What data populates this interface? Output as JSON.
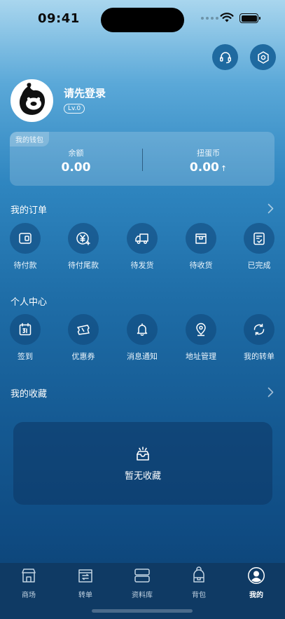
{
  "status_bar": {
    "time": "09:41"
  },
  "header": {
    "support_icon": "headset-icon",
    "settings_icon": "gear-icon"
  },
  "profile": {
    "name": "请先登录",
    "level": "Lv.0"
  },
  "wallet": {
    "tag": "我的钱包",
    "balance_label": "余额",
    "balance_value": "0.00",
    "coins_label": "扭蛋币",
    "coins_value": "0.00",
    "coins_arrow": "↑"
  },
  "orders": {
    "title": "我的订单",
    "items": [
      {
        "label": "待付款",
        "icon": "wallet-icon"
      },
      {
        "label": "待付尾款",
        "icon": "yen-coin-icon"
      },
      {
        "label": "待发货",
        "icon": "truck-icon"
      },
      {
        "label": "待收货",
        "icon": "package-icon"
      },
      {
        "label": "已完成",
        "icon": "checklist-icon"
      }
    ]
  },
  "personal": {
    "title": "个人中心",
    "items": [
      {
        "label": "签到",
        "icon": "calendar-icon"
      },
      {
        "label": "优惠券",
        "icon": "coupon-icon"
      },
      {
        "label": "消息通知",
        "icon": "bell-icon"
      },
      {
        "label": "地址管理",
        "icon": "location-pin-icon"
      },
      {
        "label": "我的转单",
        "icon": "transfer-icon"
      }
    ]
  },
  "favorites": {
    "title": "我的收藏",
    "empty_text": "暂无收藏"
  },
  "tabbar": {
    "items": [
      {
        "label": "商场",
        "icon": "store-icon"
      },
      {
        "label": "转单",
        "icon": "transfer-box-icon"
      },
      {
        "label": "资料库",
        "icon": "database-icon"
      },
      {
        "label": "背包",
        "icon": "backpack-icon"
      },
      {
        "label": "我的",
        "icon": "user-icon"
      }
    ],
    "active": "我的"
  }
}
